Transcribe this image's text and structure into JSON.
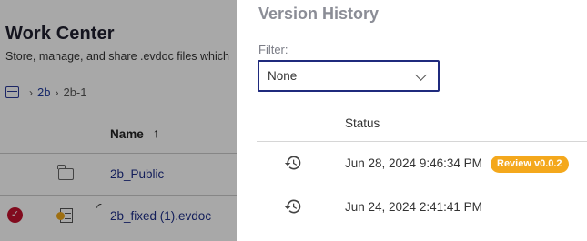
{
  "work_center": {
    "title": "Work Center",
    "subtitle": "Store, manage, and share .evdoc files which",
    "breadcrumb": {
      "items": [
        "2b",
        "2b-1"
      ]
    },
    "table": {
      "name_header": "Name",
      "sort_indicator": "↑",
      "rows": [
        {
          "name": "2b_Public",
          "icon": "folder-icon"
        },
        {
          "name": "2b_fixed (1).evdoc",
          "icon": "evdoc-file-icon",
          "selected": true
        }
      ]
    }
  },
  "version_history": {
    "title": "Version History",
    "filter": {
      "label": "Filter:",
      "value": "None"
    },
    "columns": {
      "status": "Status"
    },
    "rows": [
      {
        "timestamp": "Jun 28, 2024 9:46:34 PM",
        "badge": "Review v0.0.2"
      },
      {
        "timestamp": "Jun 24, 2024 2:41:41 PM",
        "badge": ""
      }
    ]
  },
  "colors": {
    "accent": "#1f2a7d",
    "review_badge": "#f4a81c",
    "selected_check": "#c4122e",
    "drawer_title": "#8b8d96"
  }
}
